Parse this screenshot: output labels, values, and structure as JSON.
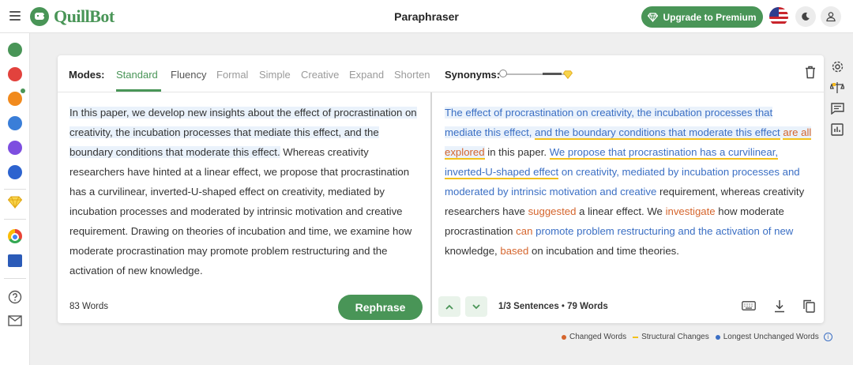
{
  "app": {
    "name": "QuillBot",
    "page_title": "Paraphraser",
    "upgrade_label": "Upgrade to Premium"
  },
  "colors": {
    "brand": "#499557",
    "changed": "#d5652d",
    "structural": "#f3c21b",
    "unchanged": "#3b6fc4"
  },
  "sidebar": {
    "icons": [
      "paraphraser-icon",
      "grammar-checker-icon",
      "ai-detector-icon",
      "co-writer-icon",
      "summarizer-icon",
      "citation-generator-icon",
      "premium-gem-icon",
      "chrome-extension-icon",
      "word-addin-icon",
      "help-icon",
      "mail-icon"
    ]
  },
  "modes": {
    "label": "Modes:",
    "items": [
      "Standard",
      "Fluency",
      "Formal",
      "Simple",
      "Creative",
      "Expand",
      "Shorten"
    ],
    "active": "Standard"
  },
  "synonyms": {
    "label": "Synonyms:"
  },
  "input": {
    "segments": [
      {
        "text": "In this paper, we develop new insights about the effect of procrastination on creativity, the incubation processes that mediate this effect, and the boundary conditions that moderate this effect.",
        "style": "hl"
      },
      {
        "text": " Whereas creativity researchers have hinted at a linear effect, we propose that procrastination has a curvilinear, inverted-U-shaped effect on creativity, mediated by incubation processes and moderated by intrinsic motivation and creative requirement. Drawing on theories of incubation and time, we examine how moderate procrastination may promote problem restructuring and the activation of new knowledge.",
        "style": ""
      }
    ],
    "word_count": "83 Words",
    "rephrase_label": "Rephrase"
  },
  "output": {
    "segments": [
      {
        "text": "The effect of procrastination on creativity, the incubation processes that mediate this effect, ",
        "style": "hl blue"
      },
      {
        "text": "and the boundary conditions that moderate this effect",
        "style": "hl blue struct"
      },
      {
        "text": " ",
        "style": "hl"
      },
      {
        "text": "are all explored",
        "style": "hl orange struct"
      },
      {
        "text": " in this paper.",
        "style": ""
      },
      {
        "text": " ",
        "style": ""
      },
      {
        "text": "We propose that procrastination has a curvilinear, inverted-U-shaped effect",
        "style": "blue struct"
      },
      {
        "text": " on creativity, mediated by incubation processes and moderated by intrinsic motivation and creative",
        "style": "blue"
      },
      {
        "text": " requirement, whereas creativity researchers have ",
        "style": ""
      },
      {
        "text": "suggested",
        "style": "orange"
      },
      {
        "text": " a linear effect. We ",
        "style": ""
      },
      {
        "text": "investigate",
        "style": "orange"
      },
      {
        "text": " how moderate procrastination ",
        "style": ""
      },
      {
        "text": "can",
        "style": "orange"
      },
      {
        "text": " ",
        "style": ""
      },
      {
        "text": "promote problem restructuring and the activation of new",
        "style": "blue"
      },
      {
        "text": " knowledge, ",
        "style": ""
      },
      {
        "text": "based",
        "style": "orange"
      },
      {
        "text": " on incubation and time theories.",
        "style": ""
      }
    ],
    "sentences": "1/3 Sentences",
    "separator": "•",
    "word_count": "79 Words"
  },
  "legend": [
    {
      "label": "Changed Words",
      "kind": "dot",
      "color": "#d5652d"
    },
    {
      "label": "Structural Changes",
      "kind": "dash",
      "color": "#f3c21b"
    },
    {
      "label": "Longest Unchanged Words",
      "kind": "dot",
      "color": "#3b6fc4"
    }
  ]
}
